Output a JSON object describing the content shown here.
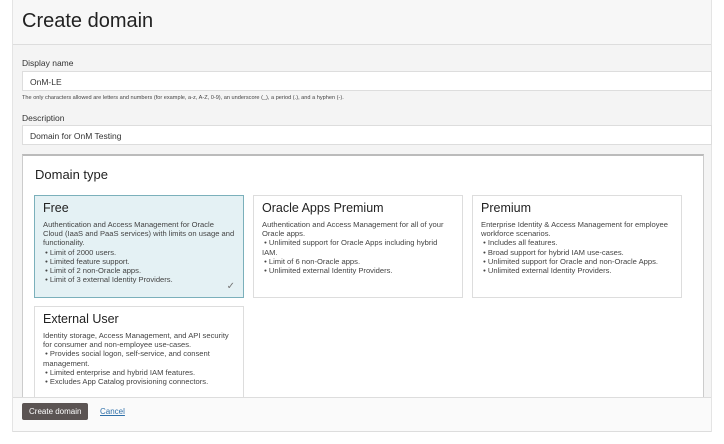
{
  "header": {
    "title": "Create domain"
  },
  "form": {
    "display_name_label": "Display name",
    "display_name_value": "OnM-LE",
    "display_name_help": "The only characters allowed are letters and numbers (for example, a-z, A-Z, 0-9), an underscore (_), a period (.), and a hyphen (-).",
    "description_label": "Description",
    "description_value": "Domain for OnM Testing"
  },
  "domain_type": {
    "title": "Domain type",
    "cards": [
      {
        "title": "Free",
        "selected": true,
        "desc": "Authentication and Access Management for Oracle Cloud (IaaS and PaaS services) with limits on usage and functionality.",
        "items": [
          "Limit of 2000 users.",
          "Limited feature support.",
          "Limit of 2 non-Oracle apps.",
          "Limit of 3 external Identity Providers."
        ]
      },
      {
        "title": "Oracle Apps Premium",
        "selected": false,
        "desc": "Authentication and Access Management for all of your Oracle apps.",
        "items": [
          "Unlimited support for Oracle Apps including hybrid IAM.",
          "Limit of 6 non-Oracle apps.",
          "Unlimited external Identity Providers."
        ]
      },
      {
        "title": "Premium",
        "selected": false,
        "desc": "Enterprise Identity & Access Management for employee workforce scenarios.",
        "items": [
          "Includes all features.",
          "Broad support for hybrid IAM use-cases.",
          "Unlimited support for Oracle and non-Oracle Apps.",
          "Unlimited external Identity Providers."
        ]
      },
      {
        "title": "External User",
        "selected": false,
        "desc": "Identity storage, Access Management, and API security for consumer and non-employee use-cases.",
        "items": [
          "Provides social logon, self-service, and consent management.",
          "Limited enterprise and hybrid IAM features.",
          "Excludes App Catalog provisioning connectors."
        ]
      }
    ]
  },
  "footer": {
    "create_label": "Create domain",
    "cancel_label": "Cancel"
  }
}
